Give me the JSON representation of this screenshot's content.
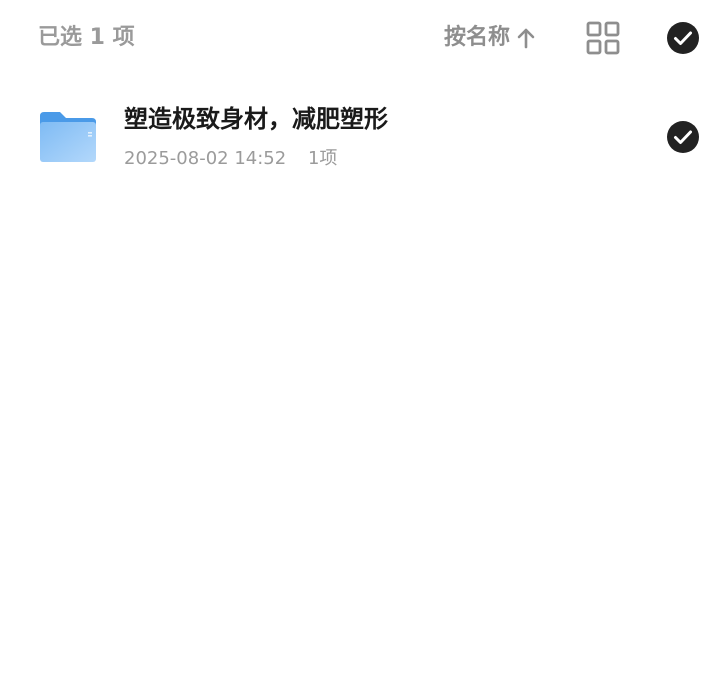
{
  "header": {
    "selected_text": "已选 1 项",
    "sort_label": "按名称",
    "sort_direction_icon": "arrow-up-icon",
    "view_toggle_icon": "grid-view-icon",
    "select_all_icon": "check-circle-icon"
  },
  "files": [
    {
      "name": "塑造极致身材，减肥塑形",
      "modified": "2025-08-02 14:52",
      "item_count": "1项",
      "type_icon": "folder-icon",
      "selected": true
    }
  ],
  "colors": {
    "muted_text": "#9a9a9a",
    "title_text": "#1a1a1a",
    "check_fill": "#222222",
    "folder_blue": "#5aa6ee"
  }
}
